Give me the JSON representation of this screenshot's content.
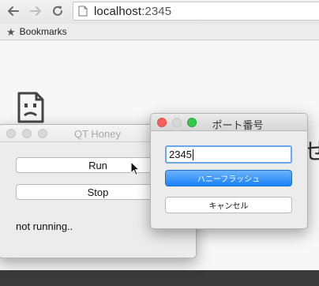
{
  "browser": {
    "url_host": "localhost",
    "url_port": ":2345",
    "bookmarks_label": "Bookmarks"
  },
  "page": {
    "partial_text": "せ"
  },
  "qt_window": {
    "title": "QT Honey",
    "run_label": "Run",
    "stop_label": "Stop",
    "status": "not running.."
  },
  "port_dialog": {
    "title": "ポート番号",
    "input_value": "2345",
    "confirm_label": "ハニーフラッシュ",
    "cancel_label": "キャンセル"
  },
  "colors": {
    "close": "#fc605c",
    "maximize": "#34c84a",
    "accent": "#1a82fb",
    "focus_ring": "#6aa7ee"
  },
  "icons": {
    "back": "arrow-left-icon",
    "forward": "arrow-right-icon",
    "reload": "reload-icon",
    "page": "page-icon",
    "bookmarks": "star-icon",
    "sad_page": "sad-page-icon",
    "cursor": "mouse-pointer-icon"
  }
}
